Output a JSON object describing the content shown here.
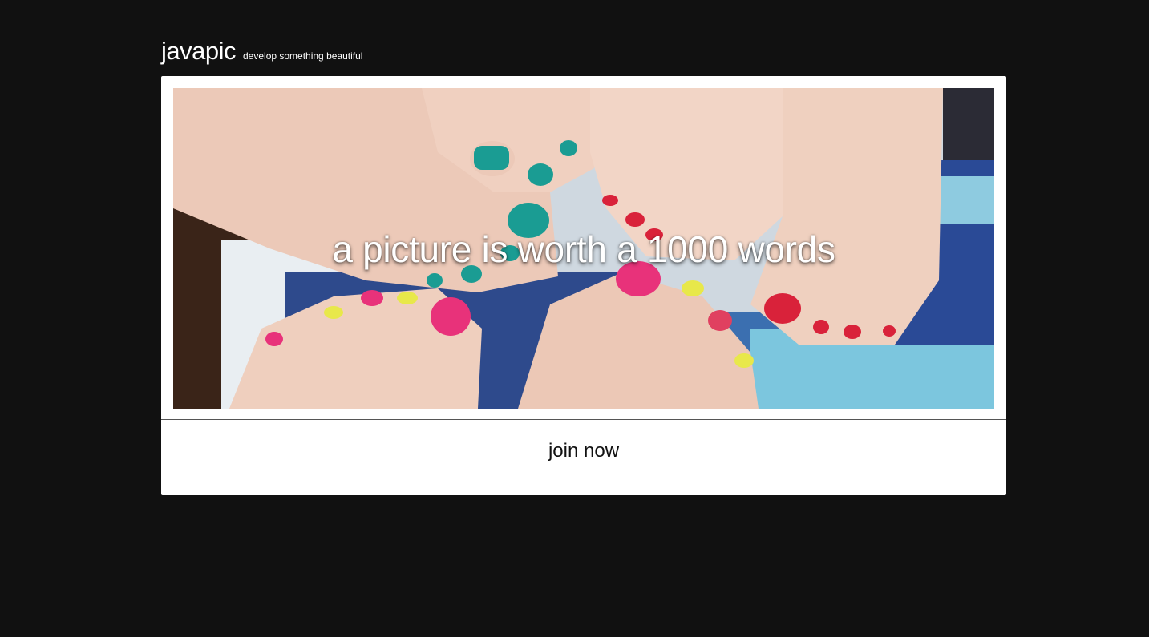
{
  "brand": {
    "name": "javapic",
    "tagline": "develop something beautiful"
  },
  "hero": {
    "caption": "a picture is worth a 1000 words",
    "image_subject": "painted-toenails-photo"
  },
  "cta": {
    "label": "join now"
  },
  "colors": {
    "background": "#111111",
    "card": "#ffffff",
    "teal_polish": "#1a9c93",
    "pink_polish": "#e8327a",
    "red_polish": "#d9223a",
    "yellow_polish": "#e8e84a",
    "blanket_blue": "#2e4a8c"
  }
}
